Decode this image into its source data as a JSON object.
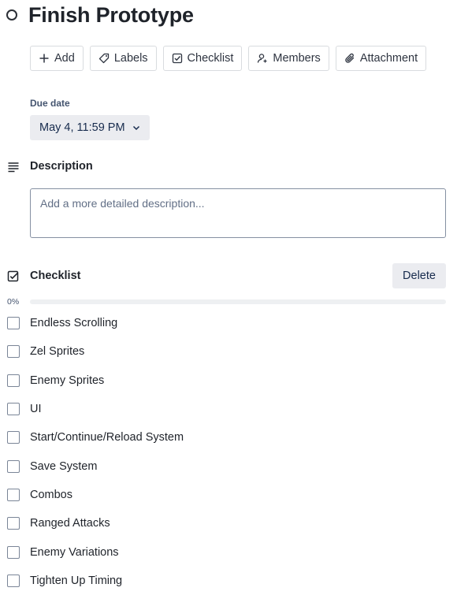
{
  "card": {
    "title": "Finish Prototype"
  },
  "actions": [
    {
      "label": "Add",
      "icon": "plus-icon"
    },
    {
      "label": "Labels",
      "icon": "tag-icon"
    },
    {
      "label": "Checklist",
      "icon": "checklist-icon"
    },
    {
      "label": "Members",
      "icon": "add-member-icon"
    },
    {
      "label": "Attachment",
      "icon": "paperclip-icon"
    }
  ],
  "due_date": {
    "label": "Due date",
    "value": "May 4, 11:59 PM"
  },
  "description": {
    "title": "Description",
    "placeholder": "Add a more detailed description..."
  },
  "checklist": {
    "title": "Checklist",
    "delete_label": "Delete",
    "progress_text": "0%",
    "progress": 0,
    "items": [
      {
        "text": "Endless Scrolling",
        "checked": false
      },
      {
        "text": "Zel Sprites",
        "checked": false
      },
      {
        "text": "Enemy Sprites",
        "checked": false
      },
      {
        "text": "UI",
        "checked": false
      },
      {
        "text": "Start/Continue/Reload System",
        "checked": false
      },
      {
        "text": "Save System",
        "checked": false
      },
      {
        "text": "Combos",
        "checked": false
      },
      {
        "text": "Ranged Attacks",
        "checked": false
      },
      {
        "text": "Enemy Variations",
        "checked": false
      },
      {
        "text": "Tighten Up Timing",
        "checked": false
      }
    ]
  },
  "colors": {
    "progress_fill": "#579dff",
    "text_primary": "#1f232a",
    "button_gray": "#ebecf0"
  }
}
